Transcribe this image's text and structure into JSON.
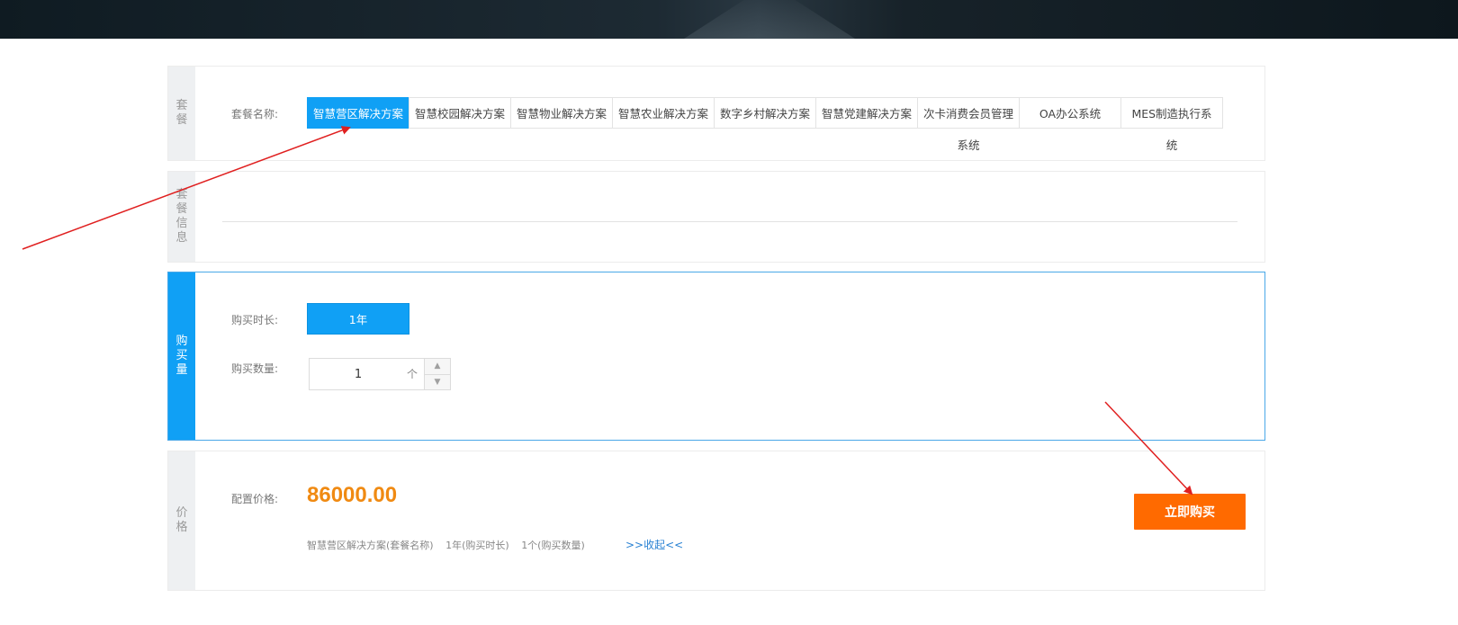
{
  "package_panel": {
    "side_label": "套餐",
    "field_label": "套餐名称:",
    "items": [
      {
        "label": "智慧营区解决方案",
        "wrap": "",
        "selected": true
      },
      {
        "label": "智慧校园解决方案",
        "wrap": "",
        "selected": false
      },
      {
        "label": "智慧物业解决方案",
        "wrap": "",
        "selected": false
      },
      {
        "label": "智慧农业解决方案",
        "wrap": "",
        "selected": false
      },
      {
        "label": "数字乡村解决方案",
        "wrap": "",
        "selected": false
      },
      {
        "label": "智慧党建解决方案",
        "wrap": "",
        "selected": false
      },
      {
        "label": "次卡消费会员管理",
        "wrap": "系统",
        "selected": false
      },
      {
        "label": "OA办公系统",
        "wrap": "",
        "selected": false
      },
      {
        "label": "MES制造执行系",
        "wrap": "统",
        "selected": false
      }
    ]
  },
  "info_panel": {
    "side_label": "套餐信息"
  },
  "purchase_panel": {
    "side_label": "购买量",
    "duration_label": "购买时长:",
    "duration_value": "1年",
    "quantity_label": "购买数量:",
    "quantity_value": "1",
    "quantity_unit": "个",
    "up_icon": "triangle-up-icon",
    "down_icon": "triangle-down-icon"
  },
  "price_panel": {
    "side_label": "价格",
    "price_label": "配置价格:",
    "price_value": "86000.00",
    "summary": [
      "智慧营区解决方案(套餐名称)",
      "1年(购买时长)",
      "1个(购买数量)"
    ],
    "collapse_link": ">>收起<<",
    "buy_button": "立即购买",
    "price_color": "#f08a12",
    "buy_color": "#ff6a00"
  },
  "theme": {
    "accent": "#10a0f5",
    "annotation_color": "#e02020"
  }
}
